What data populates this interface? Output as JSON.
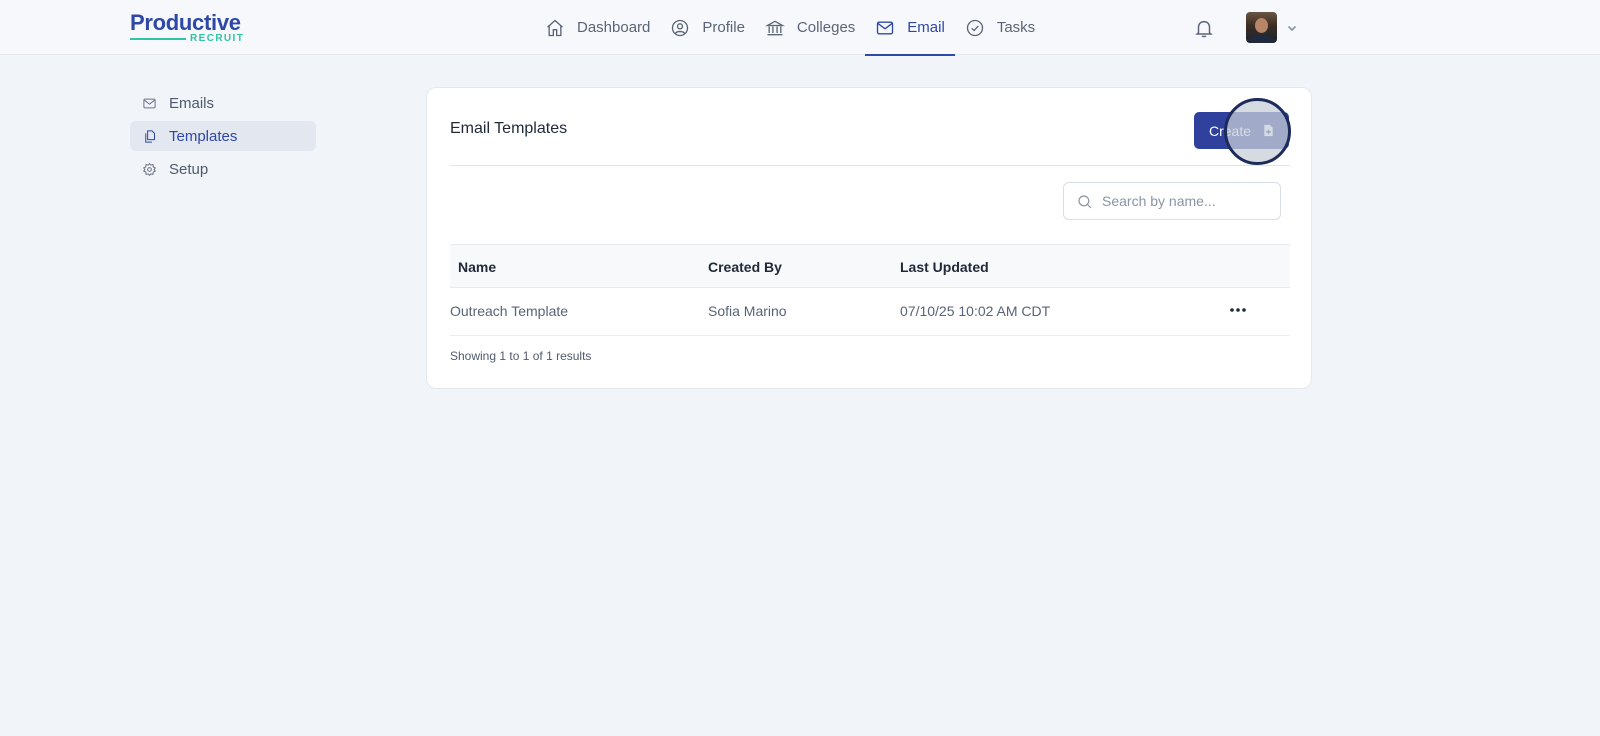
{
  "brand": {
    "name": "Productive",
    "subtitle": "RECRUIT"
  },
  "nav": {
    "items": [
      {
        "label": "Dashboard",
        "icon": "home-icon"
      },
      {
        "label": "Profile",
        "icon": "user-circle-icon"
      },
      {
        "label": "Colleges",
        "icon": "bank-icon"
      },
      {
        "label": "Email",
        "icon": "envelope-icon",
        "active": true
      },
      {
        "label": "Tasks",
        "icon": "check-circle-icon"
      }
    ],
    "notifications_icon": "bell-icon",
    "user_menu_icon": "chevron-down-icon"
  },
  "sidebar": {
    "items": [
      {
        "label": "Emails",
        "icon": "envelope-icon"
      },
      {
        "label": "Templates",
        "icon": "copy-icon",
        "active": true
      },
      {
        "label": "Setup",
        "icon": "gear-icon"
      }
    ]
  },
  "main": {
    "title": "Email Templates",
    "create_label": "Create",
    "search_placeholder": "Search by name...",
    "table": {
      "columns": [
        "Name",
        "Created By",
        "Last Updated"
      ],
      "rows": [
        {
          "name": "Outreach Template",
          "created_by": "Sofia Marino",
          "last_updated": "07/10/25 10:02 AM CDT"
        }
      ]
    },
    "results_text": "Showing 1 to 1 of 1 results"
  },
  "colors": {
    "accent": "#2f48a8",
    "button": "#2f419c",
    "brand_teal": "#2ec4a6",
    "background": "#f1f4f9"
  }
}
